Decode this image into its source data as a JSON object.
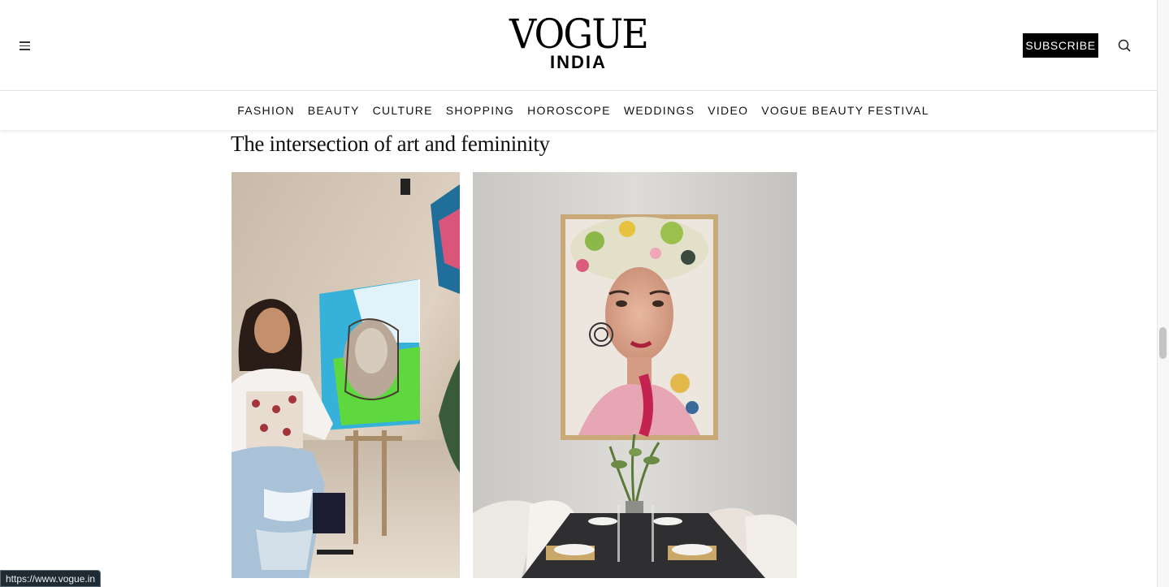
{
  "header": {
    "logo_main": "VOGUE",
    "logo_sub": "INDIA",
    "subscribe_label": "SUBSCRIBE",
    "menu_icon": "hamburger-menu-icon",
    "search_icon": "search-icon"
  },
  "nav": {
    "items": [
      {
        "label": "FASHION"
      },
      {
        "label": "BEAUTY"
      },
      {
        "label": "CULTURE"
      },
      {
        "label": "SHOPPING"
      },
      {
        "label": "HOROSCOPE"
      },
      {
        "label": "WEDDINGS"
      },
      {
        "label": "VIDEO"
      },
      {
        "label": "VOGUE BEAUTY FESTIVAL"
      }
    ]
  },
  "article": {
    "section_title": "The intersection of art and femininity"
  },
  "status_bar": {
    "url": "https://www.vogue.in"
  },
  "colors": {
    "brand_black": "#000000",
    "nav_text": "#111111",
    "status_bg": "#1f2a33"
  }
}
